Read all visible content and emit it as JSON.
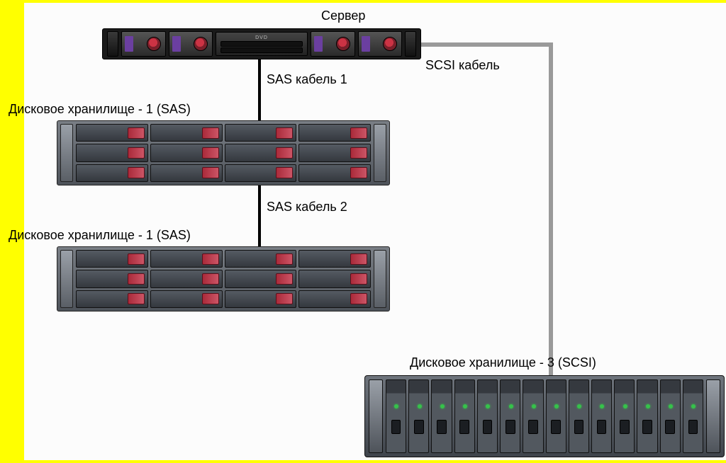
{
  "labels": {
    "server_title": "Сервер",
    "scsi_cable": "SCSI кабель",
    "sas_cable_1": "SAS кабель 1",
    "sas_cable_2": "SAS кабель 2",
    "sas_shelf_1": "Дисковое хранилище - 1 (SAS)",
    "sas_shelf_2": "Дисковое хранилище - 1 (SAS)",
    "scsi_shelf": "Дисковое хранилище - 3 (SCSI)",
    "dvd": "DVD"
  },
  "topology": {
    "server_bays": 4,
    "sas_shelves": [
      {
        "rows": 3,
        "cols": 4
      },
      {
        "rows": 3,
        "cols": 4
      }
    ],
    "scsi_drives": 14,
    "cables": [
      {
        "name": "SAS кабель 1",
        "from": "server",
        "to": "sas_shelf_1",
        "type": "SAS"
      },
      {
        "name": "SAS кабель 2",
        "from": "sas_shelf_1",
        "to": "sas_shelf_2",
        "type": "SAS"
      },
      {
        "name": "SCSI кабель",
        "from": "server",
        "to": "scsi_shelf",
        "type": "SCSI"
      }
    ]
  },
  "colors": {
    "frame": "#ffff00",
    "cable_sas": "#000000",
    "cable_scsi": "#9a9a9a",
    "drive_handle": "#cc5566",
    "led_ok": "#36c24a"
  }
}
